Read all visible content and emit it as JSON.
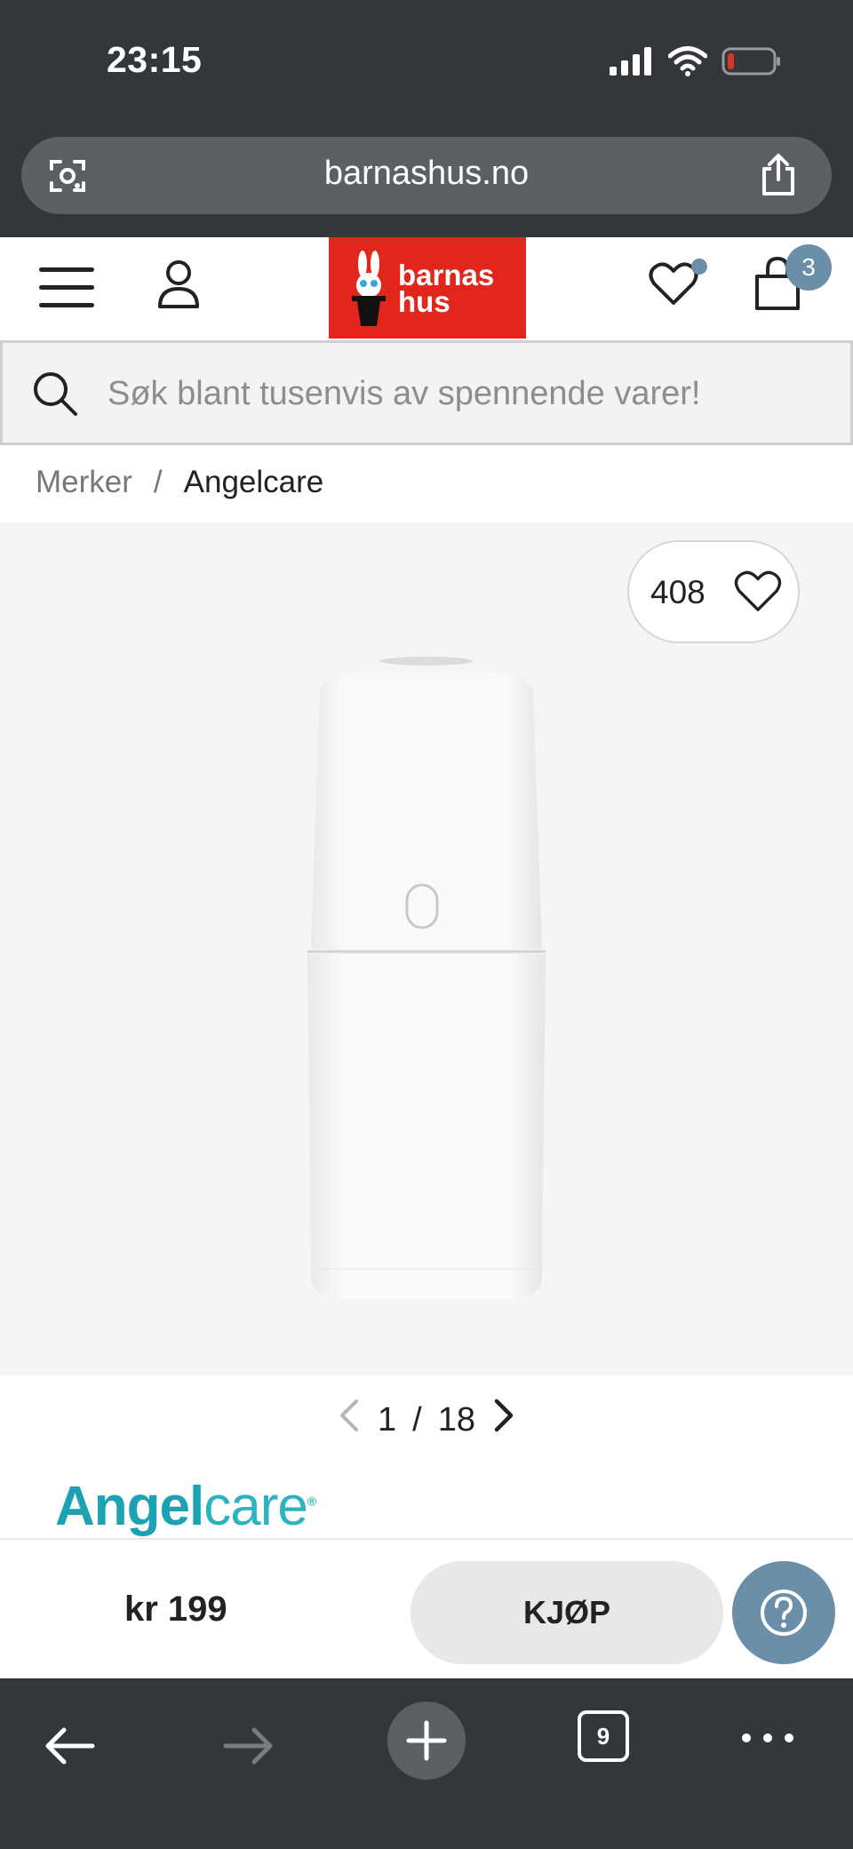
{
  "status_bar": {
    "time": "23:15"
  },
  "browser": {
    "url": "barnashus.no",
    "tabs_count": "9"
  },
  "header": {
    "logo_line1": "barnas",
    "logo_line2": "hus",
    "cart_count": "3",
    "icons": [
      "menu-icon",
      "user-icon",
      "heart-icon",
      "cart-icon"
    ]
  },
  "search": {
    "placeholder": "Søk blant tusenvis av spennende varer!"
  },
  "breadcrumb": {
    "items": [
      "Merker",
      "Angelcare"
    ],
    "separator": "/"
  },
  "product": {
    "likes": "408",
    "image_index": "1",
    "image_total": "18",
    "brand_part1": "Angel",
    "brand_part2": "care",
    "brand_reg": "®"
  },
  "buy_bar": {
    "price": "kr 199",
    "buy_label": "KJØP"
  },
  "colors": {
    "brand_red": "#e3261c",
    "accent_blue": "#6b8fa8",
    "browser_chrome": "#33363a",
    "angelcare_teal": "#1ba3b4"
  }
}
